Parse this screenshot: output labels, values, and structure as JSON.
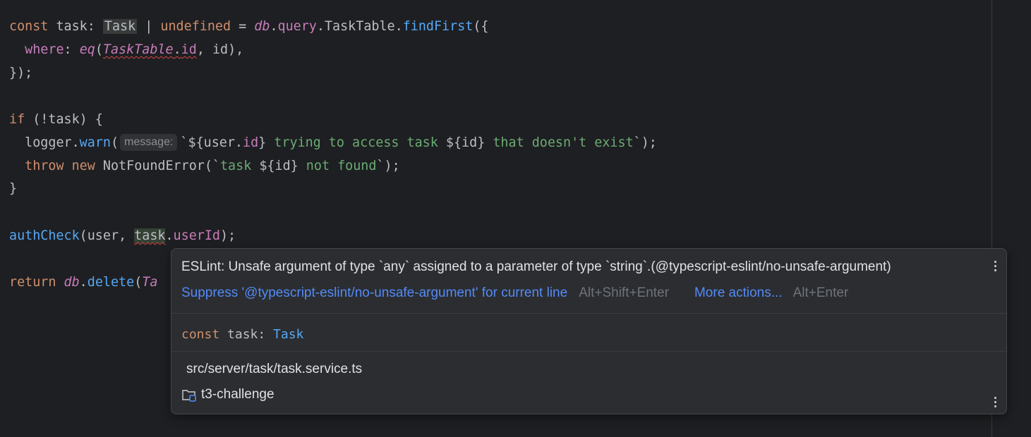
{
  "editor": {
    "lines": {
      "l1": {
        "kw_const": "const",
        "t1": " task: ",
        "type_task": "Task",
        "t2": " | ",
        "kw_undefined": "undefined",
        "t3": " = ",
        "db": "db",
        "dot1": ".",
        "query": "query",
        "t4": ".TaskTable.",
        "find_first": "findFirst",
        "t5": "({"
      },
      "l2": {
        "indent": "  ",
        "where": "where",
        "colon": ": ",
        "eq": "eq",
        "paren": "(",
        "task_table": "TaskTable",
        "dot": ".",
        "id_prop": "id",
        "rest": ", id),"
      },
      "l3": {
        "text": "});"
      },
      "l5": {
        "kw_if": "if",
        "rest": " (!task) {"
      },
      "l6": {
        "indent": "  ",
        "logger": "logger.",
        "warn": "warn",
        "paren": "(",
        "hint": "message:",
        "tmpl_start": "`${user.",
        "user_id": "id",
        "tmpl_mid1": "}",
        "str1": " trying to access task ",
        "tmpl_mid2": "${id}",
        "str2": " that doesn't exist",
        "tmpl_end": "`);"
      },
      "l7": {
        "indent": "  ",
        "kw_throw": "throw",
        "sp": " ",
        "kw_new": "new",
        "rest1": " NotFoundError(`",
        "str1": "task ",
        "interp": "${id}",
        "str2": " not found",
        "rest2": "`);"
      },
      "l8": {
        "text": "}"
      },
      "l10": {
        "auth_check": "authCheck",
        "rest1": "(user, ",
        "task": "task",
        "dot": ".",
        "user_id": "userId",
        "rest2": ");"
      },
      "l12": {
        "kw_return": "return",
        "sp": " ",
        "db": "db",
        "dot": ".",
        "delete": "delete",
        "paren": "(",
        "partial": "Ta"
      }
    }
  },
  "popup": {
    "message": "ESLint: Unsafe argument of type `any` assigned to a parameter of type `string`.(@typescript-eslint/no-unsafe-argument)",
    "suppress_label": "Suppress '@typescript-eslint/no-unsafe-argument' for current line",
    "suppress_shortcut": "Alt+Shift+Enter",
    "more_actions_label": "More actions...",
    "more_actions_shortcut": "Alt+Enter",
    "declaration": {
      "kw": "const",
      "name": " task: ",
      "type": "Task"
    },
    "file_path": "src/server/task/task.service.ts",
    "project": "t3-challenge"
  },
  "colors": {
    "background": "#1e1f22",
    "popup_background": "#2b2d30",
    "keyword": "#cf8e6d",
    "function": "#56a8f5",
    "property": "#c77dbb",
    "string": "#6aab73",
    "link": "#548af7"
  },
  "icons": {
    "project": "folder-module-icon",
    "menu": "kebab-menu-icon"
  }
}
